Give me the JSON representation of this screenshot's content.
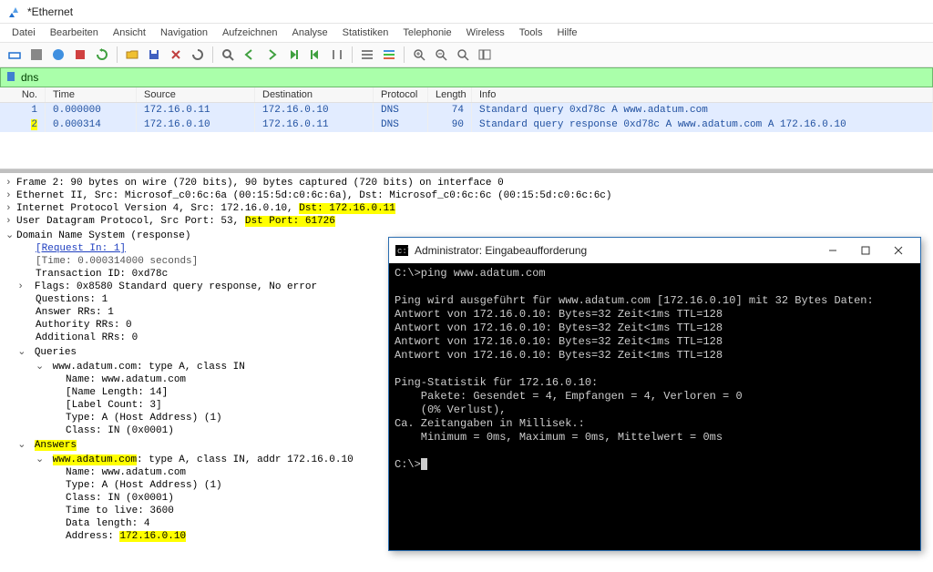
{
  "window": {
    "title": "*Ethernet"
  },
  "menu": [
    "Datei",
    "Bearbeiten",
    "Ansicht",
    "Navigation",
    "Aufzeichnen",
    "Analyse",
    "Statistiken",
    "Telephonie",
    "Wireless",
    "Tools",
    "Hilfe"
  ],
  "filter": {
    "value": "dns"
  },
  "columns": [
    "No.",
    "Time",
    "Source",
    "Destination",
    "Protocol",
    "Length",
    "Info"
  ],
  "packets": [
    {
      "no": "1",
      "time": "0.000000",
      "src": "172.16.0.11",
      "dst": "172.16.0.10",
      "proto": "DNS",
      "len": "74",
      "info": "Standard query 0xd78c A www.adatum.com"
    },
    {
      "no": "2",
      "time": "0.000314",
      "src": "172.16.0.10",
      "dst": "172.16.0.11",
      "proto": "DNS",
      "len": "90",
      "info": "Standard query response 0xd78c A www.adatum.com A 172.16.0.10"
    }
  ],
  "details": {
    "frame": "Frame 2: 90 bytes on wire (720 bits), 90 bytes captured (720 bits) on interface 0",
    "eth": "Ethernet II, Src: Microsof_c0:6c:6a (00:15:5d:c0:6c:6a), Dst: Microsof_c0:6c:6c (00:15:5d:c0:6c:6c)",
    "ip_pre": "Internet Protocol Version 4, Src: 172.16.0.10, ",
    "ip_hl": "Dst: 172.16.0.11",
    "udp_pre": "User Datagram Protocol, Src Port: 53, ",
    "udp_hl": "Dst Port: 61726",
    "dns_header": "Domain Name System (response)",
    "request_in": "[Request In: 1]",
    "time": "[Time: 0.000314000 seconds]",
    "trans_id": "Transaction ID: 0xd78c",
    "flags": "Flags: 0x8580 Standard query response, No error",
    "questions": "Questions: 1",
    "answer_rrs": "Answer RRs: 1",
    "authority_rrs": "Authority RRs: 0",
    "additional_rrs": "Additional RRs: 0",
    "queries": "Queries",
    "query_item": "www.adatum.com: type A, class IN",
    "q_name": "Name: www.adatum.com",
    "q_len": "[Name Length: 14]",
    "q_label": "[Label Count: 3]",
    "q_type": "Type: A (Host Address) (1)",
    "q_class": "Class: IN (0x0001)",
    "answers": "Answers",
    "answer_domain": "www.adatum.com",
    "answer_rest": ": type A, class IN, addr 172.16.0.10",
    "a_name": "Name: www.adatum.com",
    "a_type": "Type: A (Host Address) (1)",
    "a_class": "Class: IN (0x0001)",
    "a_ttl": "Time to live: 3600",
    "a_datalen": "Data length: 4",
    "a_addr_pre": "Address: ",
    "a_addr_hl": "172.16.0.10"
  },
  "cmd": {
    "title": "Administrator: Eingabeaufforderung",
    "lines": [
      "C:\\>ping www.adatum.com",
      "",
      "Ping wird ausgeführt für www.adatum.com [172.16.0.10] mit 32 Bytes Daten:",
      "Antwort von 172.16.0.10: Bytes=32 Zeit<1ms TTL=128",
      "Antwort von 172.16.0.10: Bytes=32 Zeit<1ms TTL=128",
      "Antwort von 172.16.0.10: Bytes=32 Zeit<1ms TTL=128",
      "Antwort von 172.16.0.10: Bytes=32 Zeit<1ms TTL=128",
      "",
      "Ping-Statistik für 172.16.0.10:",
      "    Pakete: Gesendet = 4, Empfangen = 4, Verloren = 0",
      "    (0% Verlust),",
      "Ca. Zeitangaben in Millisek.:",
      "    Minimum = 0ms, Maximum = 0ms, Mittelwert = 0ms",
      "",
      "C:\\>"
    ]
  }
}
